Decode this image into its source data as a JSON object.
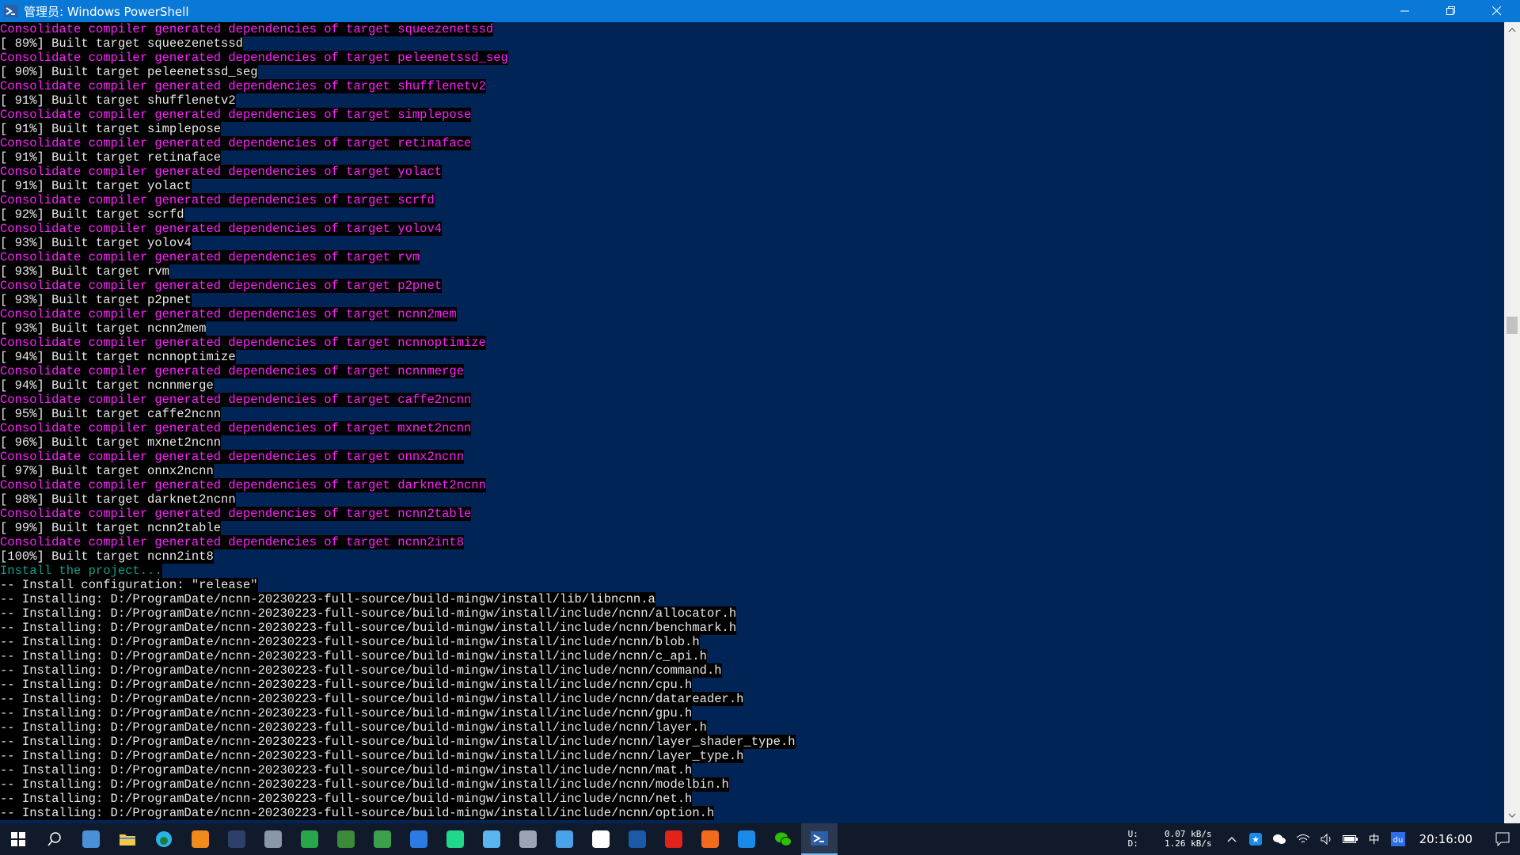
{
  "window": {
    "title": "管理员: Windows PowerShell"
  },
  "console": {
    "lines": [
      {
        "text": "Consolidate compiler generated dependencies of target squeezenetssd",
        "color": "magenta"
      },
      {
        "text": "[ 89%] Built target squeezenetssd",
        "color": "white"
      },
      {
        "text": "Consolidate compiler generated dependencies of target peleenetssd_seg",
        "color": "magenta"
      },
      {
        "text": "[ 90%] Built target peleenetssd_seg",
        "color": "white"
      },
      {
        "text": "Consolidate compiler generated dependencies of target shufflenetv2",
        "color": "magenta"
      },
      {
        "text": "[ 91%] Built target shufflenetv2",
        "color": "white"
      },
      {
        "text": "Consolidate compiler generated dependencies of target simplepose",
        "color": "magenta"
      },
      {
        "text": "[ 91%] Built target simplepose",
        "color": "white"
      },
      {
        "text": "Consolidate compiler generated dependencies of target retinaface",
        "color": "magenta"
      },
      {
        "text": "[ 91%] Built target retinaface",
        "color": "white"
      },
      {
        "text": "Consolidate compiler generated dependencies of target yolact",
        "color": "magenta"
      },
      {
        "text": "[ 91%] Built target yolact",
        "color": "white"
      },
      {
        "text": "Consolidate compiler generated dependencies of target scrfd",
        "color": "magenta"
      },
      {
        "text": "[ 92%] Built target scrfd",
        "color": "white"
      },
      {
        "text": "Consolidate compiler generated dependencies of target yolov4",
        "color": "magenta"
      },
      {
        "text": "[ 93%] Built target yolov4",
        "color": "white"
      },
      {
        "text": "Consolidate compiler generated dependencies of target rvm",
        "color": "magenta"
      },
      {
        "text": "[ 93%] Built target rvm",
        "color": "white"
      },
      {
        "text": "Consolidate compiler generated dependencies of target p2pnet",
        "color": "magenta"
      },
      {
        "text": "[ 93%] Built target p2pnet",
        "color": "white"
      },
      {
        "text": "Consolidate compiler generated dependencies of target ncnn2mem",
        "color": "magenta"
      },
      {
        "text": "[ 93%] Built target ncnn2mem",
        "color": "white"
      },
      {
        "text": "Consolidate compiler generated dependencies of target ncnnoptimize",
        "color": "magenta"
      },
      {
        "text": "[ 94%] Built target ncnnoptimize",
        "color": "white"
      },
      {
        "text": "Consolidate compiler generated dependencies of target ncnnmerge",
        "color": "magenta"
      },
      {
        "text": "[ 94%] Built target ncnnmerge",
        "color": "white"
      },
      {
        "text": "Consolidate compiler generated dependencies of target caffe2ncnn",
        "color": "magenta"
      },
      {
        "text": "[ 95%] Built target caffe2ncnn",
        "color": "white"
      },
      {
        "text": "Consolidate compiler generated dependencies of target mxnet2ncnn",
        "color": "magenta"
      },
      {
        "text": "[ 96%] Built target mxnet2ncnn",
        "color": "white"
      },
      {
        "text": "Consolidate compiler generated dependencies of target onnx2ncnn",
        "color": "magenta"
      },
      {
        "text": "[ 97%] Built target onnx2ncnn",
        "color": "white"
      },
      {
        "text": "Consolidate compiler generated dependencies of target darknet2ncnn",
        "color": "magenta"
      },
      {
        "text": "[ 98%] Built target darknet2ncnn",
        "color": "white"
      },
      {
        "text": "Consolidate compiler generated dependencies of target ncnn2table",
        "color": "magenta"
      },
      {
        "text": "[ 99%] Built target ncnn2table",
        "color": "white"
      },
      {
        "text": "Consolidate compiler generated dependencies of target ncnn2int8",
        "color": "magenta"
      },
      {
        "text": "[100%] Built target ncnn2int8",
        "color": "white"
      },
      {
        "text": "Install the project...",
        "color": "cyan"
      },
      {
        "text": "-- Install configuration: \"release\"",
        "color": "white"
      },
      {
        "text": "-- Installing: D:/ProgramDate/ncnn-20230223-full-source/build-mingw/install/lib/libncnn.a",
        "color": "white"
      },
      {
        "text": "-- Installing: D:/ProgramDate/ncnn-20230223-full-source/build-mingw/install/include/ncnn/allocator.h",
        "color": "white"
      },
      {
        "text": "-- Installing: D:/ProgramDate/ncnn-20230223-full-source/build-mingw/install/include/ncnn/benchmark.h",
        "color": "white"
      },
      {
        "text": "-- Installing: D:/ProgramDate/ncnn-20230223-full-source/build-mingw/install/include/ncnn/blob.h",
        "color": "white"
      },
      {
        "text": "-- Installing: D:/ProgramDate/ncnn-20230223-full-source/build-mingw/install/include/ncnn/c_api.h",
        "color": "white"
      },
      {
        "text": "-- Installing: D:/ProgramDate/ncnn-20230223-full-source/build-mingw/install/include/ncnn/command.h",
        "color": "white"
      },
      {
        "text": "-- Installing: D:/ProgramDate/ncnn-20230223-full-source/build-mingw/install/include/ncnn/cpu.h",
        "color": "white"
      },
      {
        "text": "-- Installing: D:/ProgramDate/ncnn-20230223-full-source/build-mingw/install/include/ncnn/datareader.h",
        "color": "white"
      },
      {
        "text": "-- Installing: D:/ProgramDate/ncnn-20230223-full-source/build-mingw/install/include/ncnn/gpu.h",
        "color": "white"
      },
      {
        "text": "-- Installing: D:/ProgramDate/ncnn-20230223-full-source/build-mingw/install/include/ncnn/layer.h",
        "color": "white"
      },
      {
        "text": "-- Installing: D:/ProgramDate/ncnn-20230223-full-source/build-mingw/install/include/ncnn/layer_shader_type.h",
        "color": "white"
      },
      {
        "text": "-- Installing: D:/ProgramDate/ncnn-20230223-full-source/build-mingw/install/include/ncnn/layer_type.h",
        "color": "white"
      },
      {
        "text": "-- Installing: D:/ProgramDate/ncnn-20230223-full-source/build-mingw/install/include/ncnn/mat.h",
        "color": "white"
      },
      {
        "text": "-- Installing: D:/ProgramDate/ncnn-20230223-full-source/build-mingw/install/include/ncnn/modelbin.h",
        "color": "white"
      },
      {
        "text": "-- Installing: D:/ProgramDate/ncnn-20230223-full-source/build-mingw/install/include/ncnn/net.h",
        "color": "white"
      },
      {
        "text": "-- Installing: D:/ProgramDate/ncnn-20230223-full-source/build-mingw/install/include/ncnn/option.h",
        "color": "white"
      }
    ]
  },
  "taskbar": {
    "apps": [
      {
        "name": "start-button",
        "icon": "windows-icon",
        "color": "#ffffff"
      },
      {
        "name": "search-button",
        "icon": "search-icon",
        "color": "#ffffff"
      },
      {
        "name": "taskbar-app-1",
        "icon": "monitor-icon",
        "color": "#4a90d9"
      },
      {
        "name": "taskbar-app-file-explorer",
        "icon": "folder-icon",
        "color": "#f2c84b"
      },
      {
        "name": "taskbar-app-edge",
        "icon": "edge-icon",
        "color": "#2bb3e8"
      },
      {
        "name": "taskbar-app-search-tool",
        "icon": "magnifier-icon",
        "color": "#f08a1c"
      },
      {
        "name": "taskbar-app-dark",
        "icon": "app-icon",
        "color": "#2d3f6b"
      },
      {
        "name": "taskbar-app-calculator",
        "icon": "calculator-icon",
        "color": "#8a97a8"
      },
      {
        "name": "taskbar-app-green-circle",
        "icon": "app-icon",
        "color": "#27a74a"
      },
      {
        "name": "taskbar-app-tree",
        "icon": "app-icon",
        "color": "#3a8a3a"
      },
      {
        "name": "taskbar-app-green-book",
        "icon": "app-icon",
        "color": "#3aa04a"
      },
      {
        "name": "taskbar-app-blue-square",
        "icon": "app-icon",
        "color": "#2c7be5"
      },
      {
        "name": "taskbar-app-pycharm",
        "icon": "app-icon",
        "color": "#21d789"
      },
      {
        "name": "taskbar-app-cloud",
        "icon": "app-icon",
        "color": "#5ab4f0"
      },
      {
        "name": "taskbar-app-gear",
        "icon": "app-icon",
        "color": "#9aa4b2"
      },
      {
        "name": "taskbar-app-mail",
        "icon": "app-icon",
        "color": "#4aa3e8"
      },
      {
        "name": "taskbar-app-typora",
        "icon": "app-icon",
        "color": "#ffffff"
      },
      {
        "name": "taskbar-app-blue-k",
        "icon": "app-icon",
        "color": "#1a5aa8"
      },
      {
        "name": "taskbar-app-netease-music",
        "icon": "app-icon",
        "color": "#e2231a"
      },
      {
        "name": "taskbar-app-orange",
        "icon": "app-icon",
        "color": "#f26b1d"
      },
      {
        "name": "taskbar-app-star",
        "icon": "app-icon",
        "color": "#1a8ae8"
      },
      {
        "name": "taskbar-app-wechat",
        "icon": "wechat-icon",
        "color": "#2dc100"
      },
      {
        "name": "taskbar-app-powershell",
        "icon": "powershell-icon",
        "color": "#2b5fa8"
      }
    ],
    "tray": {
      "net_upload_label": "U:",
      "net_upload": "0.07 kB/s",
      "net_download_label": "D:",
      "net_download": "1.26 kB/s",
      "ime": "中",
      "clock": "20:16:00"
    }
  }
}
